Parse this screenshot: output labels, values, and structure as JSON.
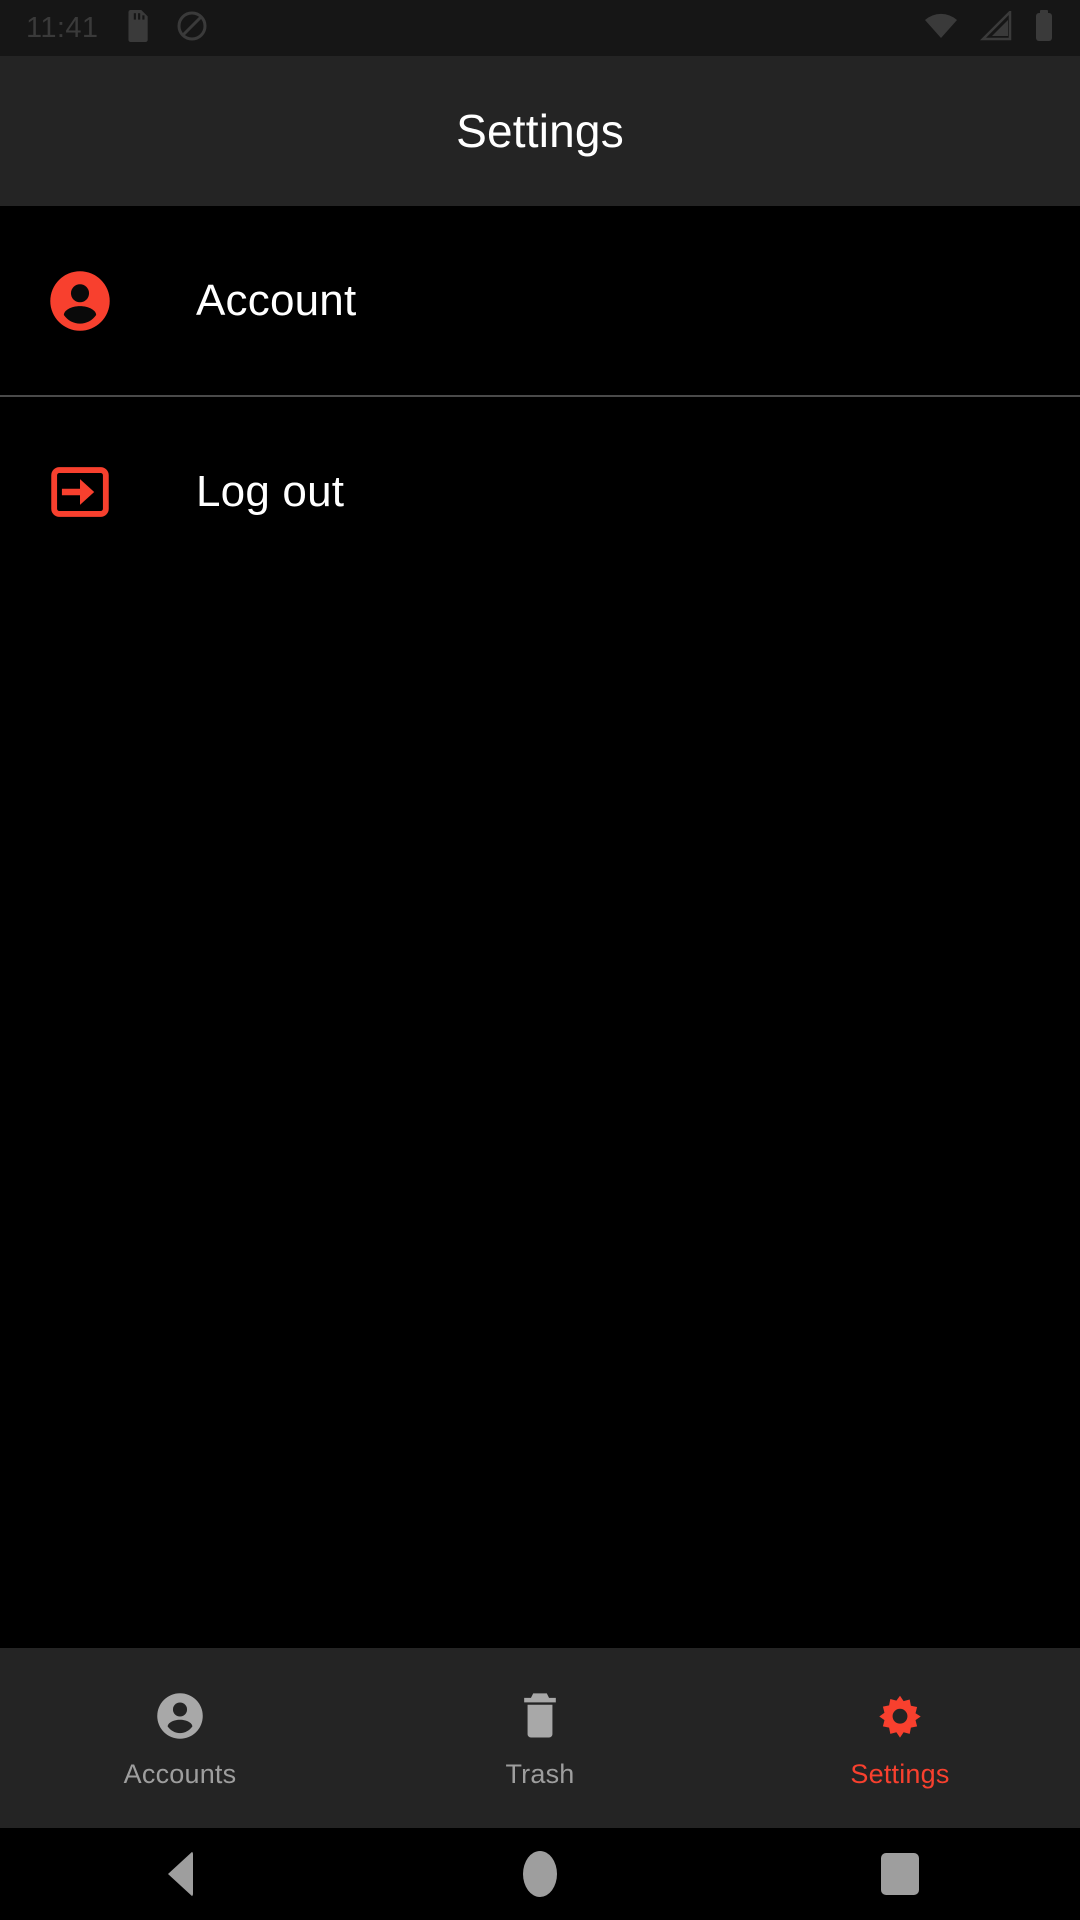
{
  "status_bar": {
    "time": "11:41",
    "left_icons": [
      "sd-card-icon",
      "do-not-disturb-icon"
    ],
    "right_icons": [
      "wifi-icon",
      "cellular-signal-icon",
      "battery-icon"
    ],
    "background_color": "#161616",
    "foreground_color": "#3a3a3a"
  },
  "app_bar": {
    "title": "Settings",
    "background_color": "#242424",
    "title_color": "#ffffff"
  },
  "settings_list": {
    "background_color": "#000000",
    "divider_color": "#4a4a4a",
    "items": [
      {
        "label": "Account",
        "icon": "account-circle-icon",
        "icon_color": "#f8402e",
        "label_color": "#ffffff"
      },
      {
        "label": "Log out",
        "icon": "logout-icon",
        "icon_color": "#f8402e",
        "label_color": "#ffffff"
      }
    ]
  },
  "bottom_nav": {
    "background_color": "#242424",
    "active_color": "#f8402e",
    "inactive_color": "#9e9e9e",
    "items": [
      {
        "label": "Accounts",
        "icon": "account-circle-icon",
        "active": false
      },
      {
        "label": "Trash",
        "icon": "trash-icon",
        "active": false
      },
      {
        "label": "Settings",
        "icon": "gear-icon",
        "active": true
      }
    ]
  },
  "system_nav": {
    "background_color": "#000000",
    "icon_color": "#9e9e9e",
    "buttons": [
      "back-icon",
      "home-icon",
      "recents-icon"
    ]
  },
  "theme": {
    "accent": "#f8402e",
    "surface": "#242424",
    "background": "#000000"
  }
}
